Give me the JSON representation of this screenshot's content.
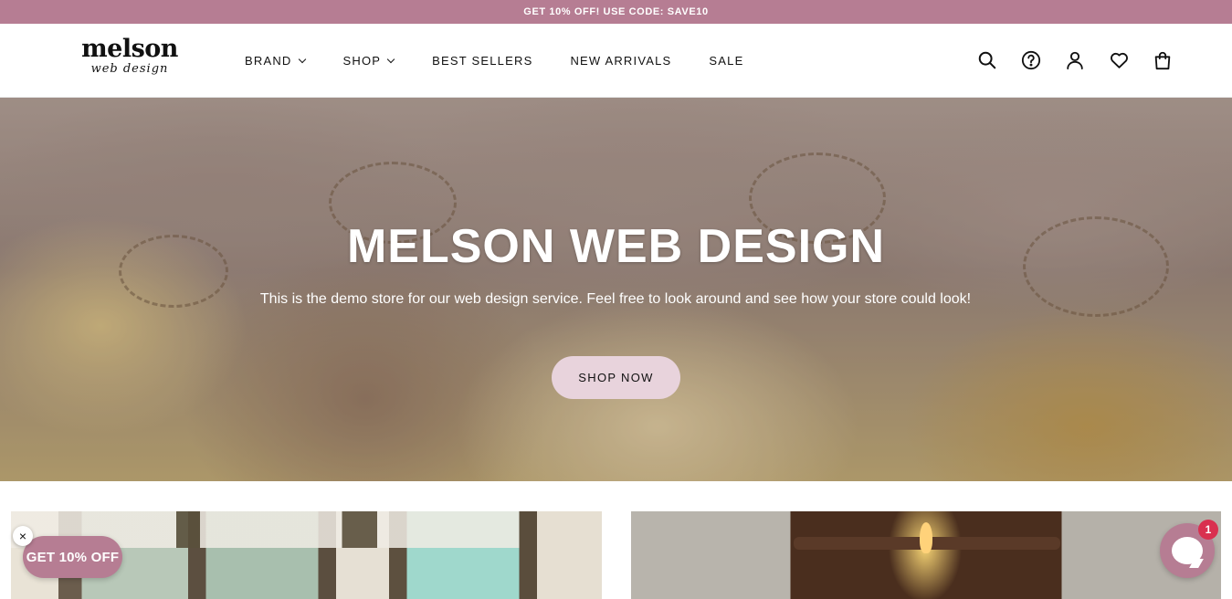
{
  "announcement": {
    "text": "GET 10% OFF! USE CODE: SAVE10"
  },
  "logo": {
    "main": "melson",
    "sub": "web design"
  },
  "nav": {
    "items": [
      {
        "label": "BRAND",
        "has_dropdown": true
      },
      {
        "label": "SHOP",
        "has_dropdown": true
      },
      {
        "label": "BEST SELLERS",
        "has_dropdown": false
      },
      {
        "label": "NEW ARRIVALS",
        "has_dropdown": false
      },
      {
        "label": "SALE",
        "has_dropdown": false
      }
    ]
  },
  "header_icons": [
    "search-icon",
    "help-icon",
    "account-icon",
    "wishlist-icon",
    "cart-icon"
  ],
  "hero": {
    "title": "MELSON WEB DESIGN",
    "text": "This is the demo store for our web design service. Feel free to look around and see how your store could look!",
    "button": "SHOP NOW"
  },
  "promo": {
    "label": "GET 10% OFF",
    "close": "×"
  },
  "chat": {
    "badge": "1"
  },
  "colors": {
    "brand": "#b67d93",
    "button_light": "#e8d3dc",
    "badge": "#d9304f"
  }
}
